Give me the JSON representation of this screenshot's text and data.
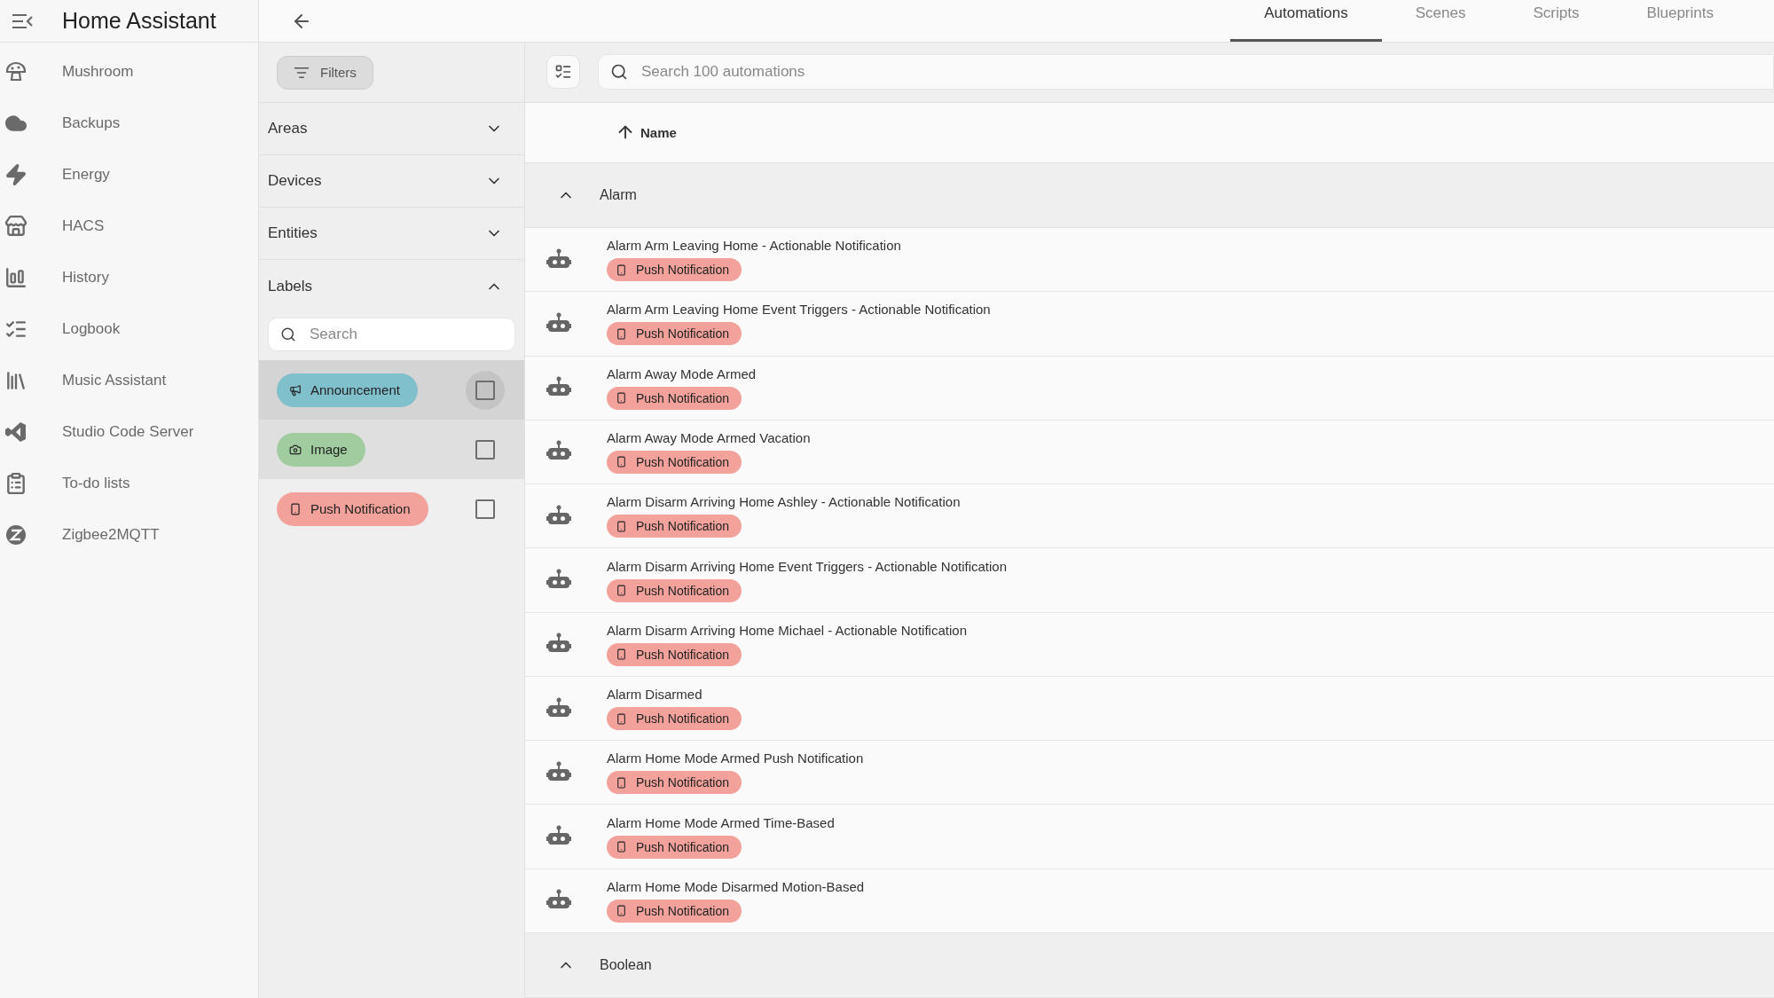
{
  "app_title": "Home Assistant",
  "sidebar": {
    "items": [
      {
        "label": "Mushroom"
      },
      {
        "label": "Backups"
      },
      {
        "label": "Energy"
      },
      {
        "label": "HACS"
      },
      {
        "label": "History"
      },
      {
        "label": "Logbook"
      },
      {
        "label": "Music Assistant"
      },
      {
        "label": "Studio Code Server"
      },
      {
        "label": "To-do lists"
      },
      {
        "label": "Zigbee2MQTT"
      }
    ]
  },
  "tabs": [
    {
      "label": "Automations",
      "selected": true
    },
    {
      "label": "Scenes",
      "selected": false
    },
    {
      "label": "Scripts",
      "selected": false
    },
    {
      "label": "Blueprints",
      "selected": false
    }
  ],
  "filters": {
    "button": "Filters",
    "sections": [
      {
        "title": "Areas",
        "expanded": false
      },
      {
        "title": "Devices",
        "expanded": false
      },
      {
        "title": "Entities",
        "expanded": false
      },
      {
        "title": "Labels",
        "expanded": true
      }
    ],
    "label_search": {
      "placeholder": "Search"
    },
    "labels": [
      {
        "name": "Announcement",
        "color": "#80bfcc",
        "focused": true,
        "hovered": false,
        "checked": false
      },
      {
        "name": "Image",
        "color": "#a0cca0",
        "focused": false,
        "hovered": true,
        "checked": false
      },
      {
        "name": "Push Notification",
        "color": "#f3a29b",
        "focused": false,
        "hovered": false,
        "checked": false
      }
    ]
  },
  "search": {
    "placeholder": "Search 100 automations"
  },
  "table": {
    "columns": [
      {
        "title": "Name",
        "sorted": true
      }
    ],
    "groups": [
      {
        "title": "Alarm",
        "expanded": true,
        "rows": [
          {
            "name": "Alarm Arm Leaving Home - Actionable Notification",
            "labels": [
              {
                "text": "Push Notification",
                "color": "#f3a29b"
              }
            ]
          },
          {
            "name": "Alarm Arm Leaving Home Event Triggers - Actionable Notification",
            "labels": [
              {
                "text": "Push Notification",
                "color": "#f3a29b"
              }
            ]
          },
          {
            "name": "Alarm Away Mode Armed",
            "labels": [
              {
                "text": "Push Notification",
                "color": "#f3a29b"
              }
            ]
          },
          {
            "name": "Alarm Away Mode Armed Vacation",
            "labels": [
              {
                "text": "Push Notification",
                "color": "#f3a29b"
              }
            ]
          },
          {
            "name": "Alarm Disarm Arriving Home Ashley - Actionable Notification",
            "labels": [
              {
                "text": "Push Notification",
                "color": "#f3a29b"
              }
            ]
          },
          {
            "name": "Alarm Disarm Arriving Home Event Triggers - Actionable Notification",
            "labels": [
              {
                "text": "Push Notification",
                "color": "#f3a29b"
              }
            ]
          },
          {
            "name": "Alarm Disarm Arriving Home Michael - Actionable Notification",
            "labels": [
              {
                "text": "Push Notification",
                "color": "#f3a29b"
              }
            ]
          },
          {
            "name": "Alarm Disarmed",
            "labels": [
              {
                "text": "Push Notification",
                "color": "#f3a29b"
              }
            ]
          },
          {
            "name": "Alarm Home Mode Armed Push Notification",
            "labels": [
              {
                "text": "Push Notification",
                "color": "#f3a29b"
              }
            ]
          },
          {
            "name": "Alarm Home Mode Armed Time-Based",
            "labels": [
              {
                "text": "Push Notification",
                "color": "#f3a29b"
              }
            ]
          },
          {
            "name": "Alarm Home Mode Disarmed Motion-Based",
            "labels": [
              {
                "text": "Push Notification",
                "color": "#f3a29b"
              }
            ]
          }
        ]
      },
      {
        "title": "Boolean",
        "expanded": true
      }
    ]
  }
}
